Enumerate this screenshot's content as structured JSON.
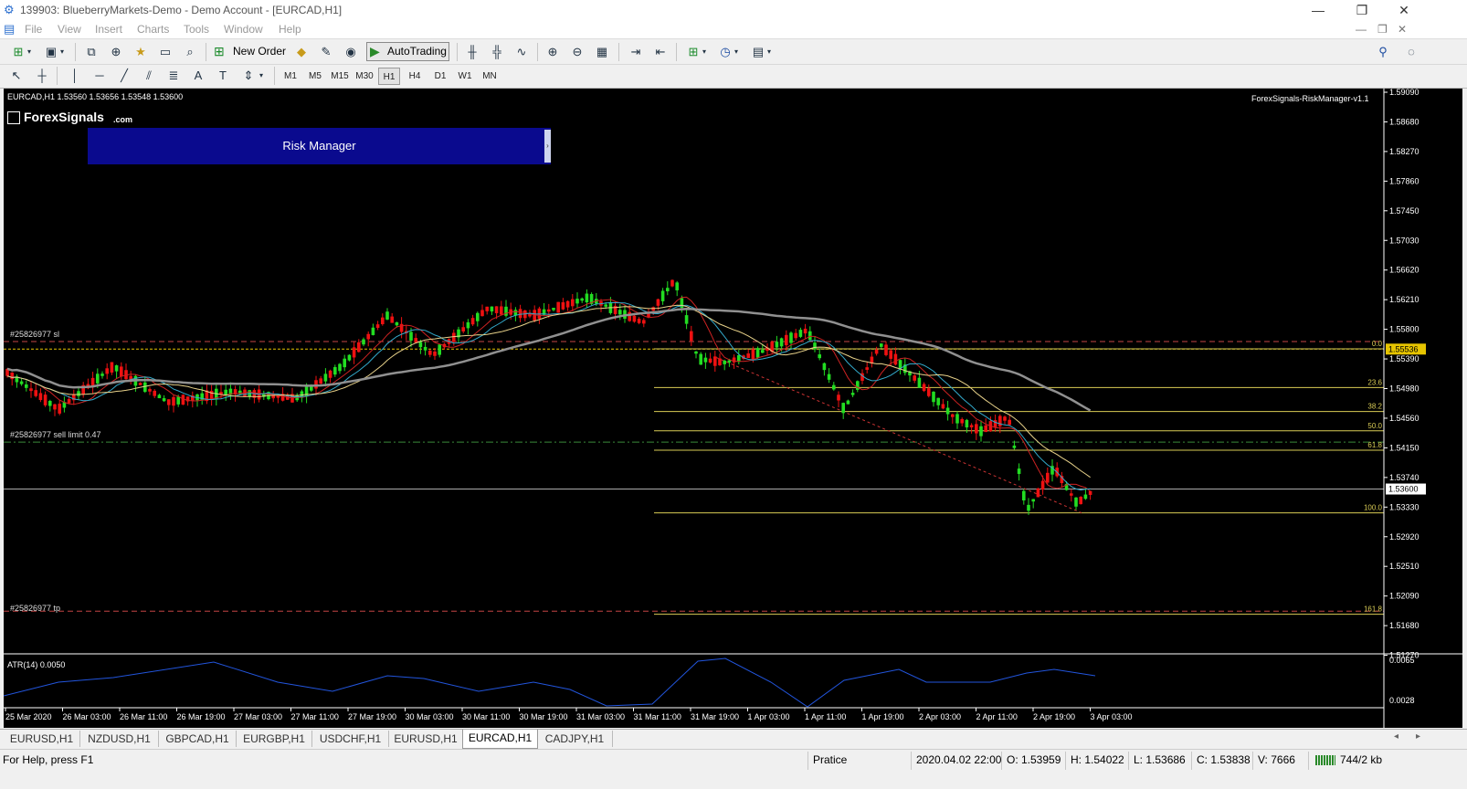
{
  "window": {
    "title": "139903: BlueberryMarkets-Demo - Demo Account - [EURCAD,H1]",
    "controls": [
      "—",
      "❐",
      "✕"
    ],
    "inner_controls": [
      "—",
      "❐",
      "✕"
    ]
  },
  "menu": [
    "File",
    "View",
    "Insert",
    "Charts",
    "Tools",
    "Window",
    "Help"
  ],
  "toolbar": {
    "new_order": "New Order",
    "autotrading": "AutoTrading"
  },
  "timeframes": [
    "M1",
    "M5",
    "M15",
    "M30",
    "H1",
    "H4",
    "D1",
    "W1",
    "MN"
  ],
  "active_timeframe": "H1",
  "chart": {
    "header": "EURCAD,H1  1.53560 1.53656 1.53548 1.53600",
    "brand_main": "ForexSignals",
    "brand_suffix": ".com",
    "risk_manager": "Risk Manager",
    "indicator_name": "ForexSignals-RiskManager-v1.1",
    "sl_label": "#25826977 sl",
    "sell_limit_label": "#25826977 sell limit 0.47",
    "tp_label": "#25826977 tp",
    "price_axis": [
      "1.59090",
      "1.58680",
      "1.58270",
      "1.57860",
      "1.57450",
      "1.57030",
      "1.56620",
      "1.56210",
      "1.55800",
      "1.55390",
      "1.54980",
      "1.54560",
      "1.54150",
      "1.53740",
      "1.53330",
      "1.52920",
      "1.52510",
      "1.52090",
      "1.51680",
      "1.51270"
    ],
    "current_price": "1.53600",
    "marked_price": "1.55536",
    "fib_levels": [
      "0.0",
      "23.6",
      "38.2",
      "50.0",
      "61.8",
      "100.0",
      "161.8"
    ],
    "atr_label": "ATR(14) 0.0050",
    "atr_axis": [
      "0.0065",
      "0.0028"
    ],
    "time_axis": [
      "25 Mar 2020",
      "26 Mar 03:00",
      "26 Mar 11:00",
      "26 Mar 19:00",
      "27 Mar 03:00",
      "27 Mar 11:00",
      "27 Mar 19:00",
      "30 Mar 03:00",
      "30 Mar 11:00",
      "30 Mar 19:00",
      "31 Mar 03:00",
      "31 Mar 11:00",
      "31 Mar 19:00",
      "1 Apr 03:00",
      "1 Apr 11:00",
      "1 Apr 19:00",
      "2 Apr 03:00",
      "2 Apr 11:00",
      "2 Apr 19:00",
      "3 Apr 03:00"
    ],
    "colors": {
      "bull": "#22dd22",
      "bear": "#ee1111",
      "fib": "#d9cc55",
      "ma_gray": "#909090",
      "atr": "#2255dd",
      "sl": "#c44444",
      "price_badge": "#e6c400"
    }
  },
  "tabs": [
    "EURUSD,H1",
    "NZDUSD,H1",
    "GBPCAD,H1",
    "EURGBP,H1",
    "USDCHF,H1",
    "EURUSD,H1",
    "EURCAD,H1",
    "CADJPY,H1"
  ],
  "active_tab": "EURCAD,H1",
  "status": {
    "help": "For Help, press F1",
    "profile": "Pratice",
    "datetime": "2020.04.02 22:00",
    "open": "O: 1.53959",
    "high": "H: 1.54022",
    "low": "L: 1.53686",
    "close": "C: 1.53838",
    "volume": "V: 7666",
    "traffic": "744/2 kb"
  }
}
